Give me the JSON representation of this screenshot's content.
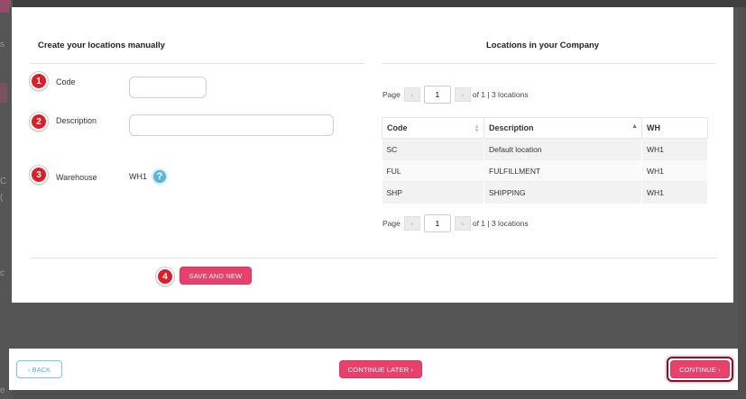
{
  "colors": {
    "accent": "#e8416c",
    "marker": "#d8202b",
    "help": "#5fb4d8",
    "back_border": "#7dc8d8"
  },
  "left_section": {
    "title": "Create your locations manually",
    "fields": [
      {
        "marker": "1",
        "label": "Code",
        "value": "",
        "placeholder": ""
      },
      {
        "marker": "2",
        "label": "Description",
        "value": "",
        "placeholder": ""
      },
      {
        "marker": "3",
        "label": "Warehouse",
        "value": "WH1",
        "help_icon": "question-icon"
      }
    ],
    "save_marker": "4",
    "save_label": "SAVE AND NEW"
  },
  "right_section": {
    "title": "Locations in your Company",
    "pager": {
      "page_label": "Page",
      "prev_icon": "‹",
      "next_icon": "›",
      "page": "1",
      "summary": "of 1 | 3 locations"
    },
    "table": {
      "columns": [
        "Code",
        "Description",
        "WH"
      ],
      "rows": [
        [
          "SC",
          "Default location",
          "WH1"
        ],
        [
          "FUL",
          "FULFILLMENT",
          "WH1"
        ],
        [
          "SHP",
          "SHIPPING",
          "WH1"
        ]
      ]
    }
  },
  "footer": {
    "back_label": "‹ BACK",
    "continue_later_label": "CONTINUE LATER ›",
    "continue_label": "CONTINUE ›"
  },
  "background": {
    "ghost_letters": [
      "s",
      "C",
      "(",
      "c",
      "e"
    ]
  }
}
